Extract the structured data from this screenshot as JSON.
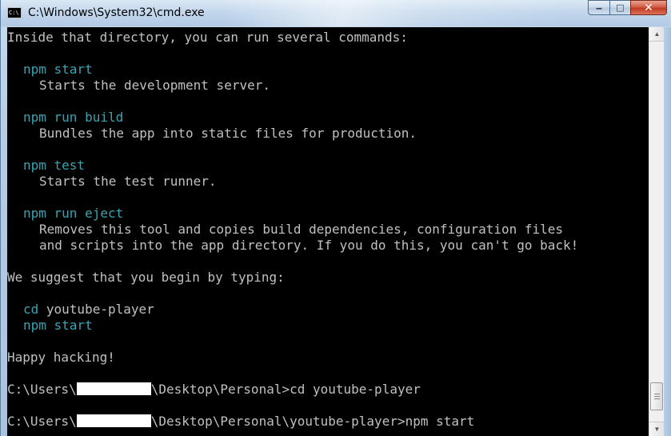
{
  "window": {
    "title": "C:\\Windows\\System32\\cmd.exe",
    "icon_text": "C:\\",
    "minimize_glyph": "‒",
    "maximize_glyph": "□",
    "close_glyph": "✕"
  },
  "console": {
    "lines": [
      {
        "text": "Inside that directory, you can run several commands:"
      },
      {
        "text": ""
      },
      {
        "text": "npm start"
      },
      {
        "text": "Starts the development server."
      },
      {
        "text": ""
      },
      {
        "text": "npm run build"
      },
      {
        "text": "Bundles the app into static files for production."
      },
      {
        "text": ""
      },
      {
        "text": "npm test"
      },
      {
        "text": "Starts the test runner."
      },
      {
        "text": ""
      },
      {
        "text": "npm run eject"
      },
      {
        "text": "Removes this tool and copies build dependencies, configuration files"
      },
      {
        "text": "and scripts into the app directory. If you do this, you can't go back!"
      },
      {
        "text": ""
      },
      {
        "text": "We suggest that you begin by typing:"
      },
      {
        "text": ""
      },
      {
        "text_cmd": "cd",
        "text_rest": " youtube-player"
      },
      {
        "text": "npm start"
      },
      {
        "text": ""
      },
      {
        "text": "Happy hacking!"
      },
      {
        "text": ""
      },
      {
        "prefix": "C:\\Users\\",
        "suffix": "\\Desktop\\Personal>cd youtube-player"
      },
      {
        "text": ""
      },
      {
        "prefix": "C:\\Users\\",
        "suffix": "\\Desktop\\Personal\\youtube-player>npm start"
      }
    ]
  },
  "colors": {
    "console_bg": "#000000",
    "console_text": "#c0c0c0",
    "command_accent": "#3aa3b0"
  },
  "scrollbar": {
    "up_glyph": "▲",
    "down_glyph": "▼"
  }
}
